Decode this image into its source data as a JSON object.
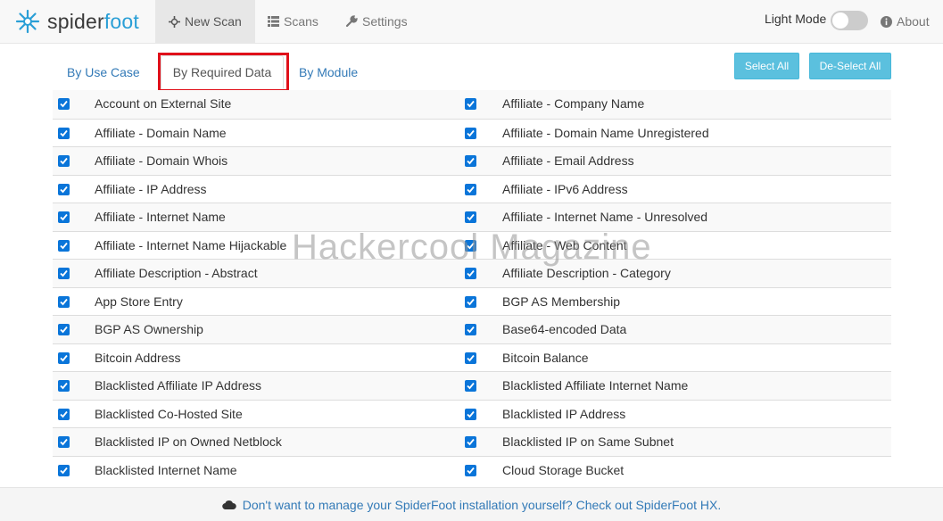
{
  "brand": {
    "prefix": "spider",
    "suffix": "foot"
  },
  "nav": {
    "new_scan": "New Scan",
    "scans": "Scans",
    "settings": "Settings",
    "light_mode": "Light Mode",
    "about": "About"
  },
  "tabs": {
    "use_case": "By Use Case",
    "required_data": "By Required Data",
    "module": "By Module"
  },
  "buttons": {
    "select_all": "Select All",
    "deselect_all": "De-Select All"
  },
  "rows": [
    {
      "left": "Account on External Site",
      "right": "Affiliate - Company Name"
    },
    {
      "left": "Affiliate - Domain Name",
      "right": "Affiliate - Domain Name Unregistered"
    },
    {
      "left": "Affiliate - Domain Whois",
      "right": "Affiliate - Email Address"
    },
    {
      "left": "Affiliate - IP Address",
      "right": "Affiliate - IPv6 Address"
    },
    {
      "left": "Affiliate - Internet Name",
      "right": "Affiliate - Internet Name - Unresolved"
    },
    {
      "left": "Affiliate - Internet Name Hijackable",
      "right": "Affiliate - Web Content"
    },
    {
      "left": "Affiliate Description - Abstract",
      "right": "Affiliate Description - Category"
    },
    {
      "left": "App Store Entry",
      "right": "BGP AS Membership"
    },
    {
      "left": "BGP AS Ownership",
      "right": "Base64-encoded Data"
    },
    {
      "left": "Bitcoin Address",
      "right": "Bitcoin Balance"
    },
    {
      "left": "Blacklisted Affiliate IP Address",
      "right": "Blacklisted Affiliate Internet Name"
    },
    {
      "left": "Blacklisted Co-Hosted Site",
      "right": "Blacklisted IP Address"
    },
    {
      "left": "Blacklisted IP on Owned Netblock",
      "right": "Blacklisted IP on Same Subnet"
    },
    {
      "left": "Blacklisted Internet Name",
      "right": "Cloud Storage Bucket"
    }
  ],
  "footer": {
    "text": "Don't want to manage your SpiderFoot installation yourself? Check out SpiderFoot HX."
  },
  "watermark": "Hackercool Magazine",
  "colors": {
    "accent": "#2a9fd6",
    "link": "#337ab7",
    "checkbox": "#0a75d9",
    "button": "#5bc0de",
    "highlight": "#e0101a"
  }
}
